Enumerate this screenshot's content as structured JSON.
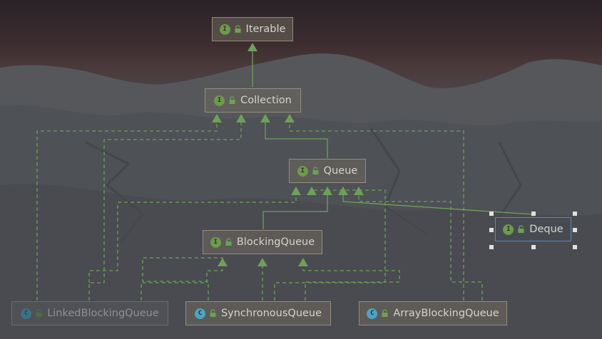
{
  "diagram": {
    "nodes": {
      "iterable": {
        "label": "Iterable",
        "kind": "interface"
      },
      "collection": {
        "label": "Collection",
        "kind": "interface"
      },
      "queue": {
        "label": "Queue",
        "kind": "interface"
      },
      "deque": {
        "label": "Deque",
        "kind": "interface",
        "selected": true
      },
      "blockingqueue": {
        "label": "BlockingQueue",
        "kind": "interface"
      },
      "linkedblockingqueue": {
        "label": "LinkedBlockingQueue",
        "kind": "class",
        "dimmed": true
      },
      "synchronousqueue": {
        "label": "SynchronousQueue",
        "kind": "class"
      },
      "arrayblockingqueue": {
        "label": "ArrayBlockingQueue",
        "kind": "class"
      }
    },
    "badges": {
      "interface": "I",
      "class": "C"
    },
    "relations": [
      {
        "from": "collection",
        "to": "iterable",
        "type": "extends"
      },
      {
        "from": "queue",
        "to": "collection",
        "type": "extends"
      },
      {
        "from": "deque",
        "to": "queue",
        "type": "extends"
      },
      {
        "from": "blockingqueue",
        "to": "queue",
        "type": "extends"
      },
      {
        "from": "linkedblockingqueue",
        "to": "collection",
        "type": "implements"
      },
      {
        "from": "linkedblockingqueue",
        "to": "queue",
        "type": "implements"
      },
      {
        "from": "linkedblockingqueue",
        "to": "blockingqueue",
        "type": "implements"
      },
      {
        "from": "synchronousqueue",
        "to": "collection",
        "type": "implements"
      },
      {
        "from": "synchronousqueue",
        "to": "queue",
        "type": "implements"
      },
      {
        "from": "synchronousqueue",
        "to": "blockingqueue",
        "type": "implements"
      },
      {
        "from": "arrayblockingqueue",
        "to": "collection",
        "type": "implements"
      },
      {
        "from": "arrayblockingqueue",
        "to": "queue",
        "type": "implements"
      },
      {
        "from": "arrayblockingqueue",
        "to": "blockingqueue",
        "type": "implements"
      }
    ],
    "colors": {
      "edge": "#6ea05a",
      "selection": "#5b86c4"
    }
  }
}
